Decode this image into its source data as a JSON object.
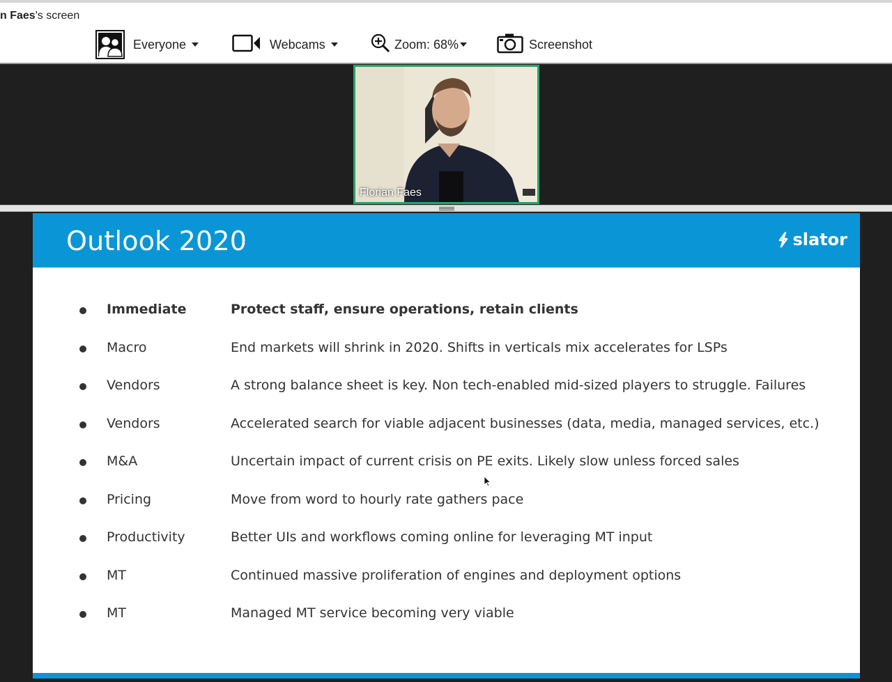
{
  "window": {
    "title_name": "n Faes",
    "title_suffix": "'s screen"
  },
  "toolbar": {
    "everyone_label": "Everyone",
    "webcams_label": "Webcams",
    "zoom_label": "Zoom: 68%",
    "screenshot_label": "Screenshot"
  },
  "webcam": {
    "participant_name": "Florian Faes"
  },
  "slide": {
    "title": "Outlook 2020",
    "logo_text": "slator",
    "rows": [
      {
        "category": "Immediate",
        "text": "Protect staff, ensure operations, retain clients"
      },
      {
        "category": "Macro",
        "text": "End markets will shrink in 2020. Shifts in verticals mix accelerates for LSPs"
      },
      {
        "category": "Vendors",
        "text": "A strong balance sheet is key. Non tech-enabled mid-sized players to struggle. Failures"
      },
      {
        "category": "Vendors",
        "text": "Accelerated search for viable adjacent businesses (data, media, managed services, etc.)"
      },
      {
        "category": "M&A",
        "text": "Uncertain impact of current crisis on PE exits. Likely slow unless forced sales"
      },
      {
        "category": "Pricing",
        "text": "Move from word to hourly rate gathers pace"
      },
      {
        "category": "Productivity",
        "text": "Better UIs and workflows coming online for leveraging MT input"
      },
      {
        "category": "MT",
        "text": "Continued massive proliferation of engines and deployment options"
      },
      {
        "category": "MT",
        "text": "Managed MT service becoming very viable"
      }
    ]
  },
  "colors": {
    "slide_accent": "#0a96d6",
    "active_speaker_border": "#2aa46a"
  }
}
